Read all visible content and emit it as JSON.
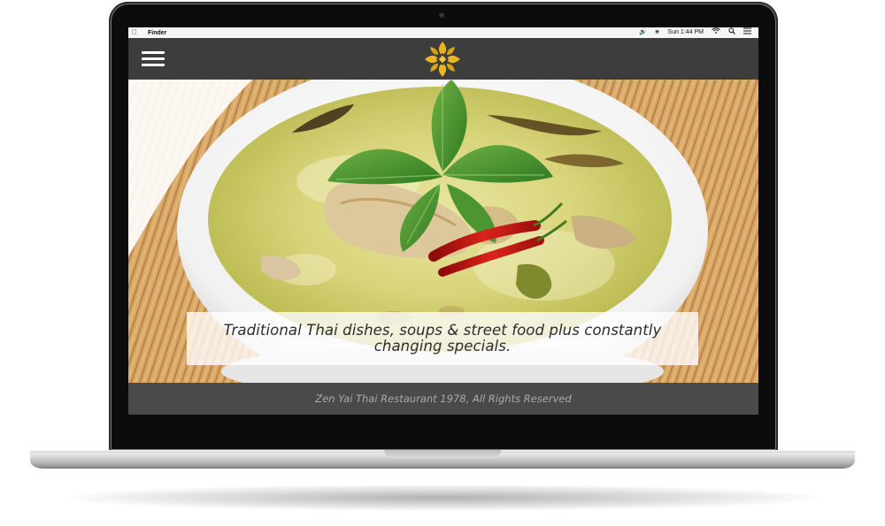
{
  "menubar": {
    "apple_icon": "apple-icon",
    "app_name": "Finder",
    "clock": "Sun 1:44 PM",
    "status_icons": [
      "volume-icon",
      "bluetooth-icon",
      "wifi-icon",
      "search-icon",
      "list-icon"
    ]
  },
  "header": {
    "menu_icon": "hamburger-menu-icon",
    "logo_icon": "lotus-logo-icon",
    "background_color": "#3d3d3d",
    "logo_color": "#e8b622"
  },
  "hero": {
    "image": "green-curry-bowl-photo",
    "tagline": "Traditional Thai dishes, soups & street food plus constantly changing specials."
  },
  "footer": {
    "copyright": "Zen Yai Thai Restaurant 1978, All Rights Reserved",
    "background_color": "#4a4a4a"
  }
}
